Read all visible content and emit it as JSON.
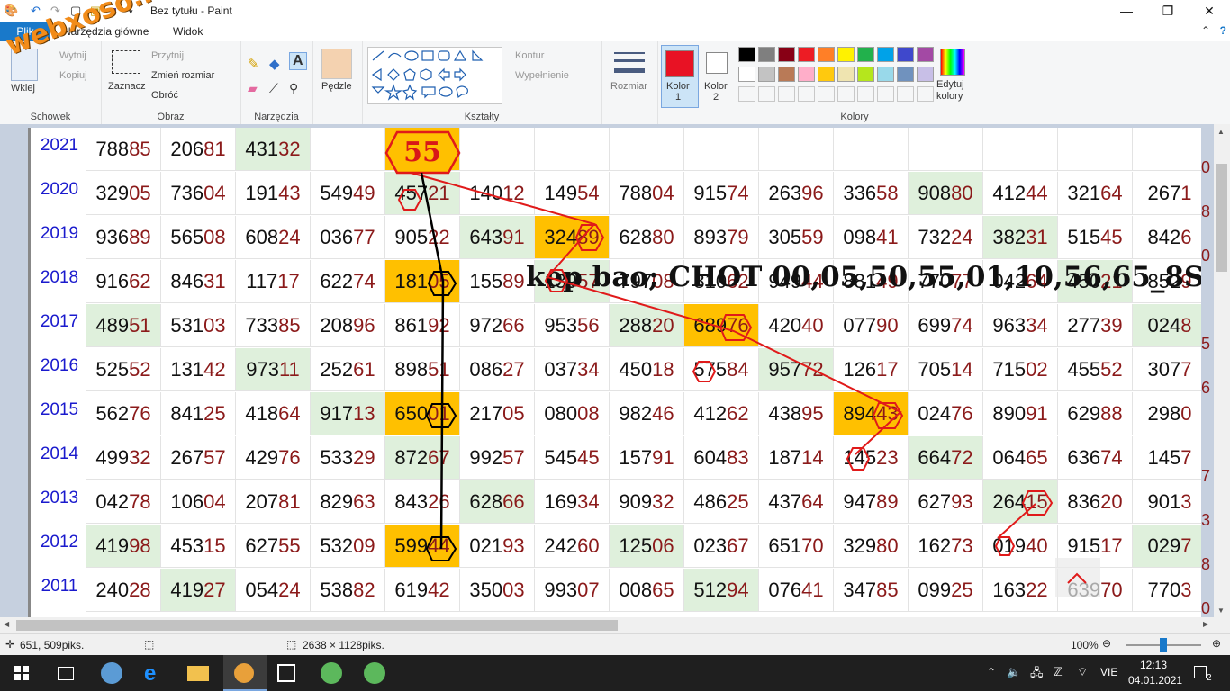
{
  "window": {
    "title": "Bez tytułu - Paint",
    "minimize_label": "—",
    "maximize_label": "❐",
    "close_label": "✕"
  },
  "menu": {
    "file_tab": "Plik",
    "tabs": [
      "Narzędzia główne",
      "Widok"
    ]
  },
  "ribbon": {
    "clipboard": {
      "label": "Schowek",
      "paste": "Wklej",
      "cut": "Wytnij",
      "copy": "Kopiuj"
    },
    "image": {
      "label": "Obraz",
      "select": "Zaznacz",
      "crop": "Przytnij",
      "resize": "Zmień rozmiar",
      "rotate": "Obróć"
    },
    "tools": {
      "label": "Narzędzia"
    },
    "brushes": {
      "label": "Pędzle"
    },
    "shapes": {
      "label": "Kształty",
      "outline": "Kontur",
      "fill": "Wypełnienie"
    },
    "size": {
      "label": "Rozmiar"
    },
    "color1": {
      "label": "Kolor",
      "number": "1",
      "color": "#e81224"
    },
    "color2": {
      "label": "Kolor",
      "number": "2",
      "color": "#ffffff"
    },
    "colors": {
      "label": "Kolory",
      "edit_label": "Edytuj kolory"
    },
    "palette": [
      "#000000",
      "#7f7f7f",
      "#880015",
      "#ed1c24",
      "#ff7f27",
      "#fff200",
      "#22b14c",
      "#00a2e8",
      "#3f48cc",
      "#a349a4",
      "#ffffff",
      "#c3c3c3",
      "#b97a57",
      "#ffaec9",
      "#ffc90e",
      "#efe4b0",
      "#b5e61d",
      "#99d9ea",
      "#7092be",
      "#c8bfe7"
    ]
  },
  "watermark": "webxoso.net",
  "headline": {
    "hex_number": "55",
    "text": "kep bao; CHOT 00,05,50,55,01,10,56,65_8S"
  },
  "table": {
    "rows": [
      {
        "year": "2021",
        "cells": [
          "78885",
          "20681",
          "43132",
          "",
          "",
          "",
          "",
          "",
          "",
          "",
          "",
          "",
          "",
          "",
          ""
        ],
        "fills": [
          "",
          "",
          "g",
          "",
          "o",
          "",
          "",
          "",
          "",
          "",
          "",
          "",
          "",
          "",
          ""
        ]
      },
      {
        "year": "2020",
        "cells": [
          "32905",
          "73604",
          "19143",
          "54949",
          "45721",
          "14012",
          "14954",
          "78804",
          "91574",
          "26396",
          "33658",
          "90880",
          "41244",
          "32164",
          "2671"
        ],
        "fills": [
          "",
          "",
          "",
          "",
          "g",
          "",
          "",
          "",
          "",
          "",
          "",
          "g",
          "",
          "",
          ""
        ]
      },
      {
        "year": "2019",
        "cells": [
          "93689",
          "56508",
          "60824",
          "03677",
          "90522",
          "64391",
          "32489",
          "62880",
          "89379",
          "30559",
          "09841",
          "73224",
          "38231",
          "51545",
          "8426"
        ],
        "fills": [
          "",
          "",
          "",
          "",
          "",
          "g",
          "o",
          "",
          "",
          "",
          "",
          "",
          "g",
          "",
          ""
        ]
      },
      {
        "year": "2018",
        "cells": [
          "91662",
          "84631",
          "11717",
          "62274",
          "18105",
          "15589",
          "13957",
          "79708",
          "81062",
          "94944",
          "88149",
          "77077",
          "04264",
          "45021",
          "8529"
        ],
        "fills": [
          "",
          "",
          "",
          "",
          "o",
          "",
          "g",
          "",
          "",
          "",
          "",
          "",
          "",
          "g",
          ""
        ]
      },
      {
        "year": "2017",
        "cells": [
          "48951",
          "53103",
          "73385",
          "20896",
          "86192",
          "97266",
          "95356",
          "28820",
          "68976",
          "42040",
          "07790",
          "69974",
          "96334",
          "27739",
          "0248"
        ],
        "fills": [
          "g",
          "",
          "",
          "",
          "",
          "",
          "",
          "g",
          "o",
          "",
          "",
          "",
          "",
          "",
          "g"
        ]
      },
      {
        "year": "2016",
        "cells": [
          "52552",
          "13142",
          "97311",
          "25261",
          "89851",
          "08627",
          "03734",
          "45018",
          "57584",
          "95772",
          "12617",
          "70514",
          "71502",
          "45552",
          "3077"
        ],
        "fills": [
          "",
          "",
          "g",
          "",
          "",
          "",
          "",
          "",
          "",
          "g",
          "",
          "",
          "",
          "",
          ""
        ]
      },
      {
        "year": "2015",
        "cells": [
          "56276",
          "84125",
          "41864",
          "91713",
          "65001",
          "21705",
          "08008",
          "98246",
          "41262",
          "43895",
          "89443",
          "02476",
          "89091",
          "62988",
          "2980"
        ],
        "fills": [
          "",
          "",
          "",
          "g",
          "o",
          "",
          "",
          "",
          "",
          "",
          "o",
          "",
          "",
          "",
          ""
        ]
      },
      {
        "year": "2014",
        "cells": [
          "49932",
          "26757",
          "42976",
          "53329",
          "87267",
          "99257",
          "54545",
          "15791",
          "60483",
          "18714",
          "14523",
          "66472",
          "06465",
          "63674",
          "1457"
        ],
        "fills": [
          "",
          "",
          "",
          "",
          "g",
          "",
          "",
          "",
          "",
          "",
          "",
          "g",
          "",
          "",
          ""
        ]
      },
      {
        "year": "2013",
        "cells": [
          "04278",
          "10604",
          "20781",
          "82963",
          "84326",
          "62866",
          "16934",
          "90932",
          "48625",
          "43764",
          "94789",
          "62793",
          "26415",
          "83620",
          "9013"
        ],
        "fills": [
          "",
          "",
          "",
          "",
          "",
          "g",
          "",
          "",
          "",
          "",
          "",
          "",
          "g",
          "",
          ""
        ]
      },
      {
        "year": "2012",
        "cells": [
          "41998",
          "45315",
          "62755",
          "53209",
          "59944",
          "02193",
          "24260",
          "12506",
          "02367",
          "65170",
          "32980",
          "16273",
          "01940",
          "91517",
          "0297"
        ],
        "fills": [
          "g",
          "",
          "",
          "",
          "o",
          "",
          "",
          "g",
          "",
          "",
          "",
          "",
          "",
          "",
          "g"
        ]
      },
      {
        "year": "2011",
        "cells": [
          "24028",
          "41927",
          "05424",
          "53882",
          "61942",
          "35003",
          "99307",
          "00865",
          "51294",
          "07641",
          "34785",
          "09925",
          "16322",
          "63970",
          "7703"
        ],
        "fills": [
          "",
          "g",
          "",
          "",
          "",
          "",
          "",
          "",
          "g",
          "",
          "",
          "",
          "",
          "",
          ""
        ]
      }
    ],
    "right_edge_chars": [
      "0",
      "8",
      "0",
      "",
      "5",
      "6",
      "",
      "7",
      "3",
      "8",
      "0"
    ]
  },
  "status": {
    "cursor_pos": "651, 509piks.",
    "image_size": "2638 × 1128piks.",
    "zoom": "100%"
  },
  "taskbar": {
    "language": "VIE",
    "time": "12:13",
    "date": "04.01.2021",
    "notification_count": "2"
  }
}
